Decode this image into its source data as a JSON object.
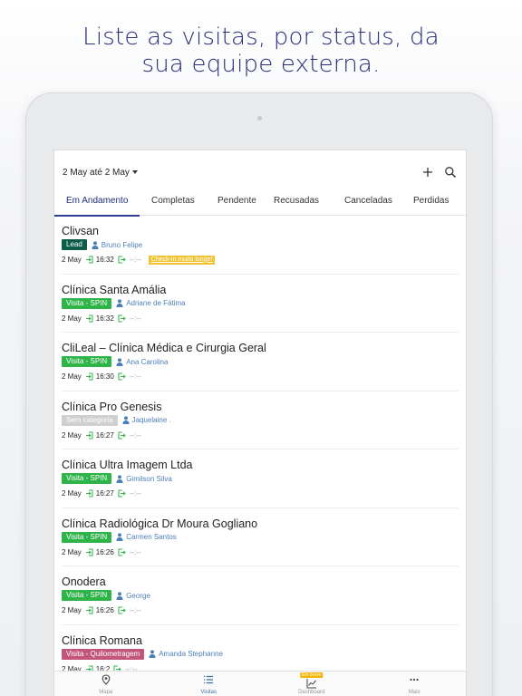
{
  "headline": {
    "line1": "Liste as visitas, por status, da",
    "line2": "sua equipe externa."
  },
  "toolbar": {
    "date_range": "2 May até 2 May",
    "add_icon": "plus-icon",
    "search_icon": "search-icon"
  },
  "tabs": [
    "Em Andamento",
    "Completas",
    "Pendente",
    "Recusadas",
    "Canceladas",
    "Perdidas"
  ],
  "colors": {
    "accent": "#2a3f8f",
    "tag_green": "#2fb44a",
    "tag_lead": "#0b5d4a",
    "tag_gray": "#cfcfcf",
    "tag_pink": "#c2567a",
    "person": "#4c7fb8"
  },
  "visits": [
    {
      "title": "Clivsan",
      "tag": "Lead",
      "person": "Bruno Felipe",
      "date": "2 May",
      "time": "16:32",
      "checkout": "--:--",
      "warning": "Check-in muito longe!"
    },
    {
      "title": "Clínica Santa Amália",
      "tag": "Visita - SPIN",
      "person": "Adriane de Fátima",
      "date": "2 May",
      "time": "16:32",
      "checkout": "--:--"
    },
    {
      "title": "CliLeal – Clínica Médica e Cirurgia Geral",
      "tag": "Visita - SPIN",
      "person": "Ana Carolina",
      "date": "2 May",
      "time": "16:30",
      "checkout": "--:--"
    },
    {
      "title": "Clínica Pro Genesis",
      "tag": "Sem categoria",
      "person": "Jaquelaine .",
      "date": "2 May",
      "time": "16:27",
      "checkout": "--:--"
    },
    {
      "title": "Clínica Ultra Imagem Ltda",
      "tag": "Visita - SPIN",
      "person": "Gimilson Silva",
      "date": "2 May",
      "time": "16:27",
      "checkout": "--:--"
    },
    {
      "title": "Clínica Radiológica Dr Moura Gogliano",
      "tag": "Visita - SPIN",
      "person": "Carmen Santos",
      "date": "2 May",
      "time": "16:26",
      "checkout": "--:--"
    },
    {
      "title": "Onodera",
      "tag": "Visita - SPIN",
      "person": "George",
      "date": "2 May",
      "time": "16:26",
      "checkout": "--:--"
    },
    {
      "title": "Clínica Romana",
      "tag": "Visita - Quilometragem",
      "person": "Amanda Stephanne",
      "date": "2 May",
      "time": "16:2",
      "checkout": "--:--"
    }
  ],
  "bottom_nav": [
    {
      "label": "Mapa",
      "icon": "map-pin-icon"
    },
    {
      "label": "Visitas",
      "icon": "list-icon"
    },
    {
      "label": "Dashboard",
      "icon": "chart-icon",
      "badge": "Em breve"
    },
    {
      "label": "Mais",
      "icon": "more-icon"
    }
  ]
}
